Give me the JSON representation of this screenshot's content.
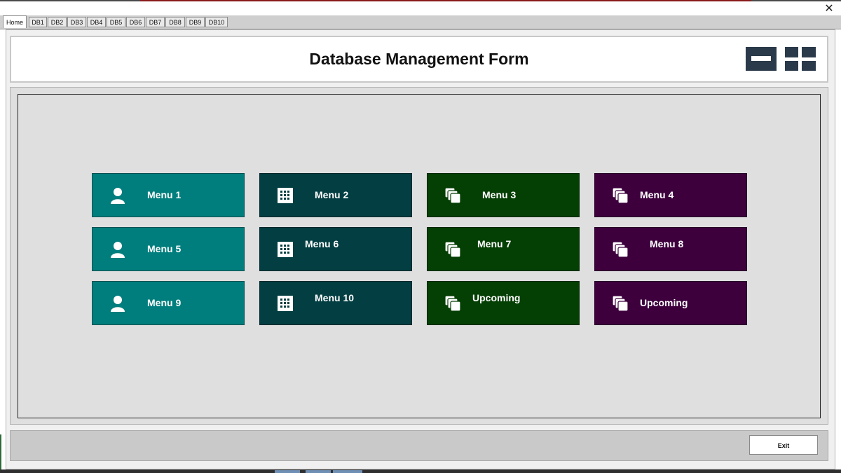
{
  "window": {
    "close_glyph": "✕"
  },
  "tabs": [
    {
      "label": "Home",
      "active": true
    },
    {
      "label": "DB1"
    },
    {
      "label": "DB2"
    },
    {
      "label": "DB3"
    },
    {
      "label": "DB4"
    },
    {
      "label": "DB5"
    },
    {
      "label": "DB6"
    },
    {
      "label": "DB7"
    },
    {
      "label": "DB8"
    },
    {
      "label": "DB9"
    },
    {
      "label": "DB10"
    }
  ],
  "header": {
    "title": "Database Management Form",
    "minimize_icon": "minimize-icon",
    "maximize_icon": "grid-maximize-icon"
  },
  "colors": {
    "teal": "#007e7d",
    "dark_teal": "#023e42",
    "dark_green": "#043f04",
    "purple": "#3d003d",
    "window_button": "#2b3a4a"
  },
  "menu": {
    "tiles": [
      {
        "label": "Menu 1",
        "icon": "user-icon"
      },
      {
        "label": "Menu 2",
        "icon": "table-grid-icon"
      },
      {
        "label": "Menu 3",
        "icon": "stacked-pages-icon"
      },
      {
        "label": "Menu 4",
        "icon": "stacked-pages-icon"
      },
      {
        "label": "Menu 5",
        "icon": "user-icon"
      },
      {
        "label": "Menu 6",
        "icon": "table-grid-icon"
      },
      {
        "label": "Menu 7",
        "icon": "stacked-pages-icon"
      },
      {
        "label": "Menu 8",
        "icon": "stacked-pages-icon"
      },
      {
        "label": "Menu 9",
        "icon": "user-icon"
      },
      {
        "label": "Menu 10",
        "icon": "table-grid-icon"
      },
      {
        "label": "Upcoming",
        "icon": "stacked-pages-icon"
      },
      {
        "label": "Upcoming",
        "icon": "stacked-pages-icon"
      }
    ]
  },
  "footer": {
    "exit_label": "Exit"
  }
}
